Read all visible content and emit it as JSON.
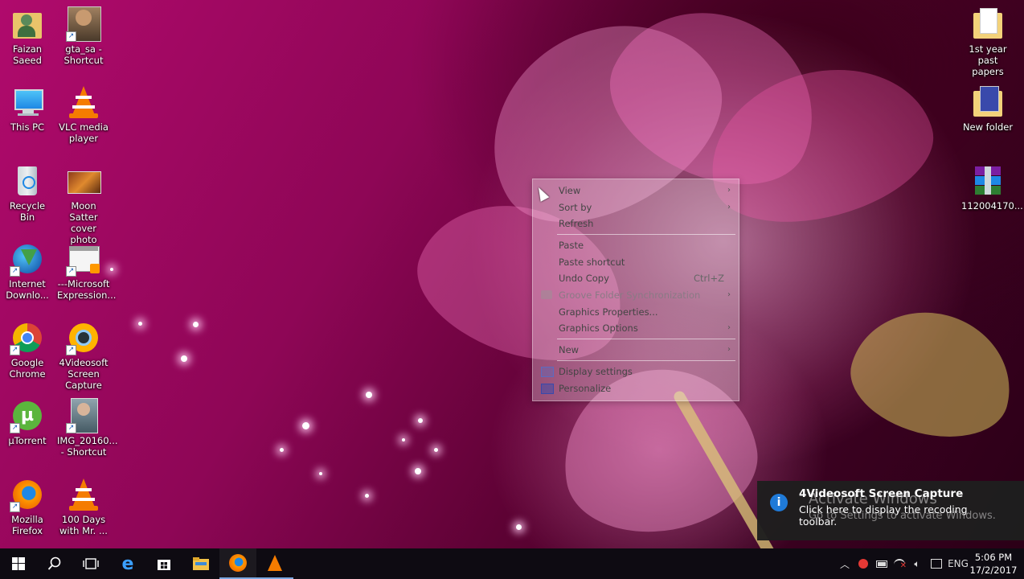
{
  "desktop": {
    "icons_left": [
      {
        "label": "Faizan Saeed",
        "icon": "user-folder-icon"
      },
      {
        "label": "gta_sa - Shortcut",
        "icon": "game-shortcut-icon"
      },
      {
        "label": "This PC",
        "icon": "computer-icon"
      },
      {
        "label": "VLC media player",
        "icon": "vlc-icon"
      },
      {
        "label": "Recycle Bin",
        "icon": "recycle-bin-icon"
      },
      {
        "label": "Moon Satter cover photo",
        "icon": "image-icon"
      },
      {
        "label": "Internet Downlo...",
        "icon": "idm-icon"
      },
      {
        "label": "---Microsoft Expression...",
        "icon": "app-window-icon"
      },
      {
        "label": "Google Chrome",
        "icon": "chrome-icon"
      },
      {
        "label": "4Videosoft Screen Capture",
        "icon": "screen-capture-icon"
      },
      {
        "label": "µTorrent",
        "icon": "utorrent-icon"
      },
      {
        "label": "IMG_20160... - Shortcut",
        "icon": "photo-shortcut-icon"
      },
      {
        "label": "Mozilla Firefox",
        "icon": "firefox-icon"
      },
      {
        "label": "100 Days with Mr. ...",
        "icon": "vlc-icon"
      }
    ],
    "icons_right": [
      {
        "label": "1st year past papers",
        "icon": "folder-icon"
      },
      {
        "label": "New folder",
        "icon": "folder-icon"
      },
      {
        "label": "112004170...",
        "icon": "winrar-icon"
      }
    ]
  },
  "context_menu": {
    "items": [
      {
        "label": "View",
        "submenu": true
      },
      {
        "label": "Sort by",
        "submenu": true
      },
      {
        "label": "Refresh"
      },
      {
        "label": "Paste"
      },
      {
        "label": "Paste shortcut"
      },
      {
        "label": "Undo Copy",
        "shortcut": "Ctrl+Z"
      },
      {
        "label": "Groove Folder Synchronization",
        "submenu": true,
        "disabled": true
      },
      {
        "label": "Graphics Properties..."
      },
      {
        "label": "Graphics Options",
        "submenu": true
      },
      {
        "label": "New",
        "submenu": true
      },
      {
        "label": "Display settings"
      },
      {
        "label": "Personalize"
      }
    ]
  },
  "notification": {
    "title": "4Videosoft Screen Capture",
    "body": "Click here to display the recoding toolbar.",
    "watermark_title": "Activate Windows",
    "watermark_body": "Go to Settings to activate Windows."
  },
  "taskbar": {
    "pinned": [
      "start-icon",
      "search-icon",
      "task-view-icon",
      "edge-icon",
      "store-icon",
      "file-explorer-icon",
      "firefox-icon",
      "vlc-icon"
    ],
    "language": "ENG",
    "time": "5:06 PM",
    "date": "17/2/2017"
  }
}
